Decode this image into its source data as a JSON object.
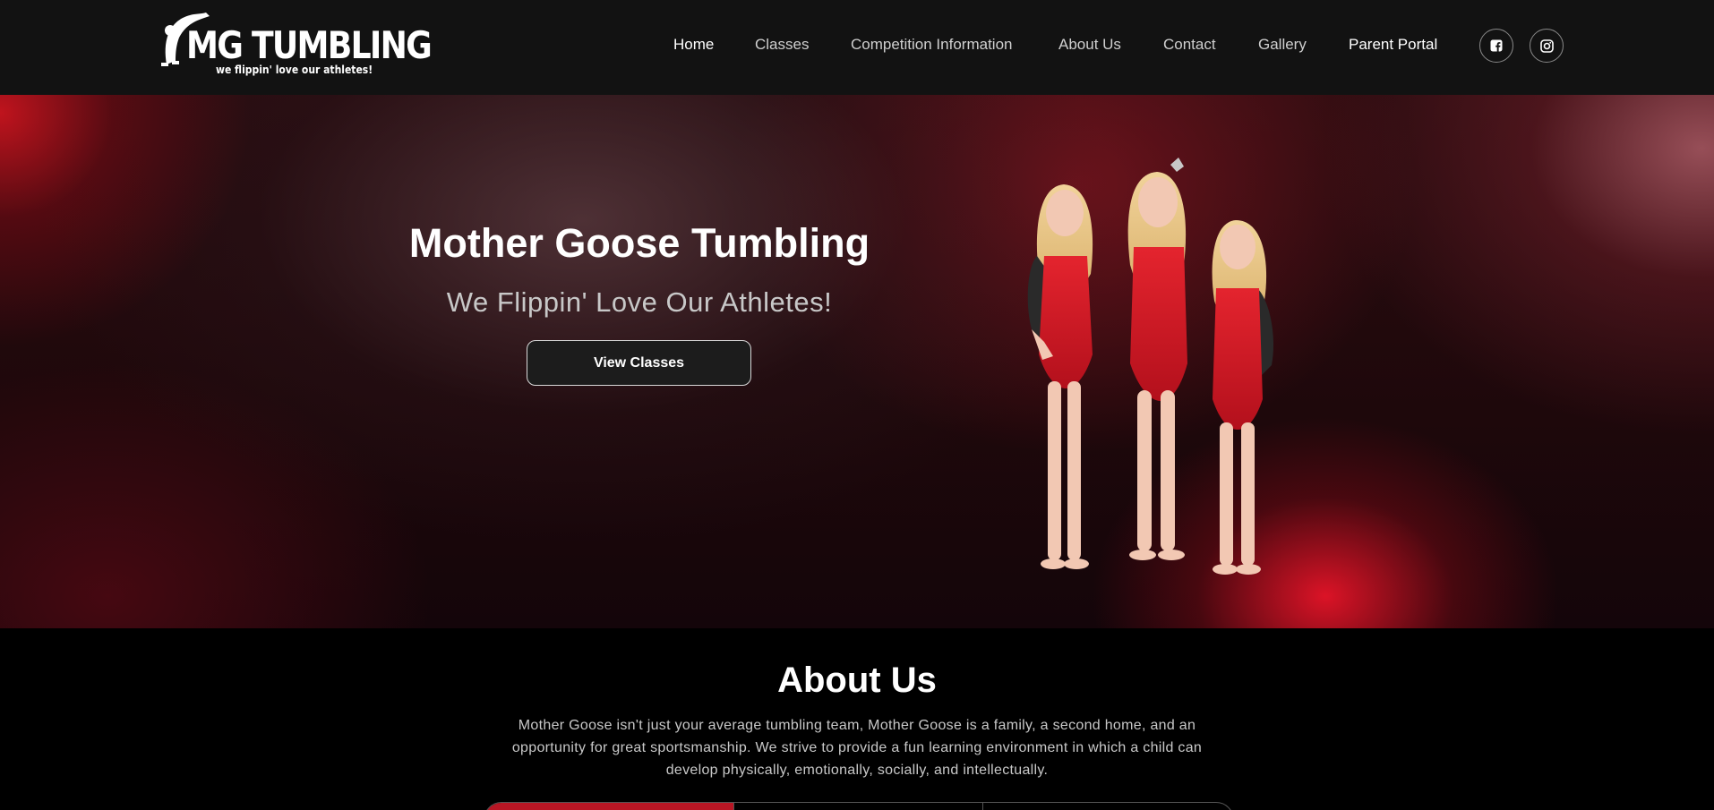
{
  "brand": {
    "name": "MG TUMBLING",
    "tagline": "we flippin' love our athletes!"
  },
  "nav": {
    "items": [
      {
        "label": "Home",
        "active": true
      },
      {
        "label": "Classes"
      },
      {
        "label": "Competition Information"
      },
      {
        "label": "About Us"
      },
      {
        "label": "Contact"
      },
      {
        "label": "Gallery"
      },
      {
        "label": "Parent Portal"
      }
    ],
    "social": [
      "facebook-icon",
      "instagram-icon"
    ]
  },
  "hero": {
    "title": "Mother Goose Tumbling",
    "subtitle": "We Flippin' Love Our Athletes!",
    "button": "View Classes"
  },
  "about": {
    "title": "About Us",
    "text": "Mother Goose isn't just your average tumbling team, Mother Goose is a family, a second home, and an opportunity for great sportsmanship. We strive to provide a fun learning environment in which a child can develop physically, emotionally, socially, and intellectually."
  },
  "colors": {
    "accent": "#b81624",
    "nav_bg": "#121212",
    "button_bg": "#1c1c1c"
  }
}
